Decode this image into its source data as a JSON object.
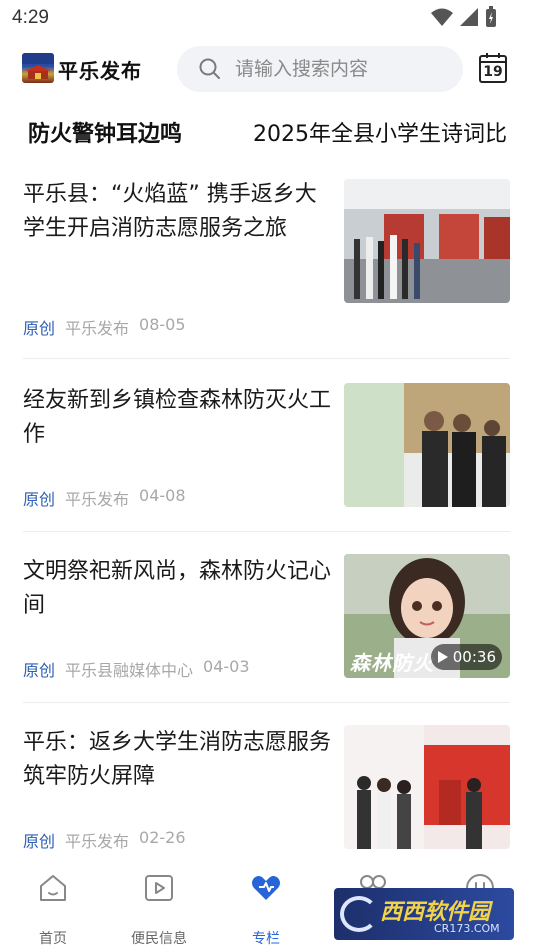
{
  "status_bar": {
    "time": "4:29"
  },
  "header": {
    "app_name": "平乐发布",
    "search_placeholder": "请输入搜索内容",
    "calendar_day": "19"
  },
  "topics": [
    "防火警钟耳边鸣",
    "2025年全县小学生诗词比"
  ],
  "articles": [
    {
      "title": "平乐县：“火焰蓝” 携手返乡大学生开启消防志愿服务之旅",
      "tag": "原创",
      "source": "平乐发布",
      "date": "08-05"
    },
    {
      "title": "经友新到乡镇检查森林防灭火工作",
      "tag": "原创",
      "source": "平乐发布",
      "date": "04-08"
    },
    {
      "title": "文明祭祀新风尚，森林防火记心间",
      "tag": "原创",
      "source": "平乐县融媒体中心",
      "date": "04-03",
      "video_duration": "00:36",
      "thumb_caption": "森林防火"
    },
    {
      "title": "平乐：返乡大学生消防志愿服务筑牢防火屏障",
      "tag": "原创",
      "source": "平乐发布",
      "date": "02-26"
    }
  ],
  "bottom_nav": [
    {
      "label": "首页",
      "icon": "home-icon"
    },
    {
      "label": "便民信息",
      "icon": "play-icon"
    },
    {
      "label": "专栏",
      "icon": "heart-icon"
    },
    {
      "label": "",
      "icon": "grid-icon"
    },
    {
      "label": "",
      "icon": "smile-icon"
    }
  ],
  "watermark": {
    "text": "西西软件园",
    "url": "CR173.COM"
  },
  "colors": {
    "accent": "#2764d8",
    "tag": "#2d5fb4",
    "meta": "#a8a8a8"
  }
}
